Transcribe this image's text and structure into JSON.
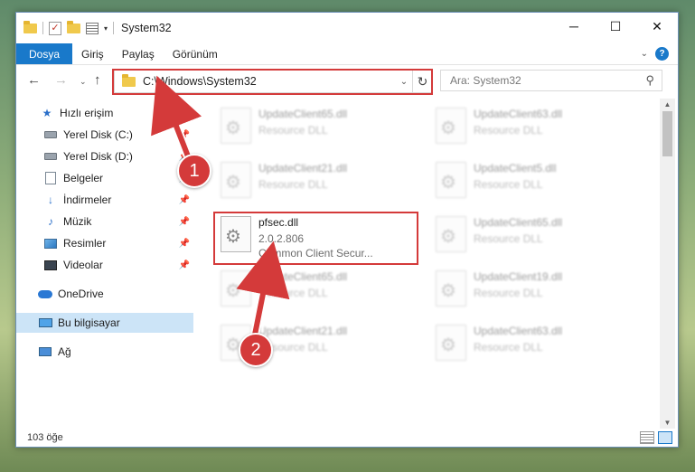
{
  "window": {
    "title": "System32"
  },
  "qat": {
    "dropdown_glyph": "▾"
  },
  "winbtns": {
    "minimize": "─",
    "maximize": "☐",
    "close": "✕"
  },
  "ribbon": {
    "tabs": [
      "Dosya",
      "Giriş",
      "Paylaş",
      "Görünüm"
    ],
    "help": "?"
  },
  "address": {
    "path": "C:\\Windows\\System32"
  },
  "search": {
    "placeholder": "Ara: System32"
  },
  "sidebar": {
    "items": [
      {
        "label": "Hızlı erişim",
        "icon": "star-icon"
      },
      {
        "label": "Yerel Disk (C:)",
        "icon": "drive-icon",
        "pinned": true
      },
      {
        "label": "Yerel Disk (D:)",
        "icon": "drive-icon",
        "pinned": true
      },
      {
        "label": "Belgeler",
        "icon": "document-icon",
        "pinned": true
      },
      {
        "label": "İndirmeler",
        "icon": "download-icon",
        "pinned": true
      },
      {
        "label": "Müzik",
        "icon": "music-icon",
        "pinned": true
      },
      {
        "label": "Resimler",
        "icon": "pictures-icon",
        "pinned": true
      },
      {
        "label": "Videolar",
        "icon": "videos-icon",
        "pinned": true
      },
      {
        "label": "OneDrive",
        "icon": "onedrive-icon"
      },
      {
        "label": "Bu bilgisayar",
        "icon": "computer-icon",
        "selected": true
      },
      {
        "label": "Ağ",
        "icon": "network-icon"
      }
    ]
  },
  "files": [
    {
      "name": "UpdateClient65.dll",
      "line2": "Resource DLL",
      "line3": ""
    },
    {
      "name": "UpdateClient63.dll",
      "line2": "Resource DLL",
      "line3": ""
    },
    {
      "name": "UpdateClient21.dll",
      "line2": "Resource DLL",
      "line3": ""
    },
    {
      "name": "UpdateClient5.dll",
      "line2": "Resource DLL",
      "line3": ""
    },
    {
      "name": "pfsec.dll",
      "line2": "2.0.2.806",
      "line3": "Common Client Secur..."
    },
    {
      "name": "UpdateClient65.dll",
      "line2": "Resource DLL",
      "line3": ""
    },
    {
      "name": "UpdateClient65.dll",
      "line2": "Resource DLL",
      "line3": ""
    },
    {
      "name": "UpdateClient19.dll",
      "line2": "Resource DLL",
      "line3": ""
    },
    {
      "name": "UpdateClient21.dll",
      "line2": "Resource DLL",
      "line3": ""
    },
    {
      "name": "UpdateClient63.dll",
      "line2": "Resource DLL",
      "line3": ""
    }
  ],
  "status": {
    "count": "103 öğe"
  },
  "callouts": [
    "1",
    "2"
  ],
  "colors": {
    "accent": "#1979ca",
    "highlight": "#d43a3a",
    "selected": "#cce4f7"
  }
}
